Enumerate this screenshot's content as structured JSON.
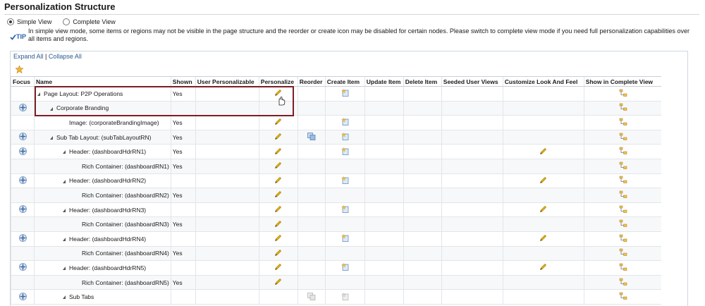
{
  "page": {
    "title": "Personalization Structure"
  },
  "view_mode": {
    "options": [
      {
        "label": "Simple View",
        "selected": true
      },
      {
        "label": "Complete View",
        "selected": false
      }
    ]
  },
  "tip": {
    "badge": "TIP",
    "text": "In simple view mode, some items or regions may not be visible in the page structure and the reorder or create icon may be disabled for certain nodes. Please switch to complete view mode if you need full personalization capabilities over all items and regions."
  },
  "toolbar": {
    "expand_all": "Expand All",
    "separator": "|",
    "collapse_all": "Collapse All"
  },
  "table": {
    "columns": [
      "Focus",
      "Name",
      "Shown",
      "User Personalizable",
      "Personalize",
      "Reorder",
      "Create Item",
      "Update Item",
      "Delete Item",
      "Seeded User Views",
      "Customize Look And Feel",
      "Show in Complete View"
    ],
    "rows": [
      {
        "name": "Page Layout: P2P Operations",
        "level": 0,
        "toggle": true,
        "focus": false,
        "shown": "Yes",
        "personalize": true,
        "reorder": "none",
        "create": true,
        "customize": false,
        "complete": true
      },
      {
        "name": "Corporate Branding",
        "level": 1,
        "toggle": true,
        "focus": true,
        "shown": "",
        "personalize": false,
        "reorder": "none",
        "create": false,
        "customize": false,
        "complete": true
      },
      {
        "name": "Image: (corporateBrandingImage)",
        "level": 2,
        "toggle": false,
        "focus": false,
        "shown": "Yes",
        "personalize": true,
        "reorder": "none",
        "create": true,
        "customize": false,
        "complete": true
      },
      {
        "name": "Sub Tab Layout: (subTabLayoutRN)",
        "level": 1,
        "toggle": true,
        "focus": true,
        "shown": "Yes",
        "personalize": true,
        "reorder": "active",
        "create": true,
        "customize": false,
        "complete": true
      },
      {
        "name": "Header: (dashboardHdrRN1)",
        "level": 2,
        "toggle": true,
        "focus": true,
        "shown": "Yes",
        "personalize": true,
        "reorder": "none",
        "create": true,
        "customize": true,
        "complete": true
      },
      {
        "name": "Rich Container: (dashboardRN1)",
        "level": 3,
        "toggle": false,
        "focus": false,
        "shown": "Yes",
        "personalize": true,
        "reorder": "none",
        "create": false,
        "customize": false,
        "complete": true
      },
      {
        "name": "Header: (dashboardHdrRN2)",
        "level": 2,
        "toggle": true,
        "focus": true,
        "shown": "",
        "personalize": true,
        "reorder": "none",
        "create": true,
        "customize": true,
        "complete": true
      },
      {
        "name": "Rich Container: (dashboardRN2)",
        "level": 3,
        "toggle": false,
        "focus": false,
        "shown": "Yes",
        "personalize": true,
        "reorder": "none",
        "create": false,
        "customize": false,
        "complete": true
      },
      {
        "name": "Header: (dashboardHdrRN3)",
        "level": 2,
        "toggle": true,
        "focus": true,
        "shown": "",
        "personalize": true,
        "reorder": "none",
        "create": true,
        "customize": true,
        "complete": true
      },
      {
        "name": "Rich Container: (dashboardRN3)",
        "level": 3,
        "toggle": false,
        "focus": false,
        "shown": "Yes",
        "personalize": true,
        "reorder": "none",
        "create": false,
        "customize": false,
        "complete": true
      },
      {
        "name": "Header: (dashboardHdrRN4)",
        "level": 2,
        "toggle": true,
        "focus": true,
        "shown": "",
        "personalize": true,
        "reorder": "none",
        "create": true,
        "customize": true,
        "complete": true
      },
      {
        "name": "Rich Container: (dashboardRN4)",
        "level": 3,
        "toggle": false,
        "focus": false,
        "shown": "Yes",
        "personalize": true,
        "reorder": "none",
        "create": false,
        "customize": false,
        "complete": true
      },
      {
        "name": "Header: (dashboardHdrRN5)",
        "level": 2,
        "toggle": true,
        "focus": true,
        "shown": "",
        "personalize": true,
        "reorder": "none",
        "create": true,
        "customize": true,
        "complete": true
      },
      {
        "name": "Rich Container: (dashboardRN5)",
        "level": 3,
        "toggle": false,
        "focus": false,
        "shown": "Yes",
        "personalize": true,
        "reorder": "none",
        "create": false,
        "customize": false,
        "complete": true
      },
      {
        "name": "Sub Tabs",
        "level": 2,
        "toggle": true,
        "focus": true,
        "shown": "",
        "personalize": false,
        "reorder": "disabled",
        "create": "disabled",
        "customize": false,
        "complete": true
      }
    ]
  },
  "colors": {
    "accent_link": "#2a5b8f",
    "highlight_border": "#7a1f26",
    "pencil": "#d9a400",
    "tip_blue": "#2d64b0"
  }
}
